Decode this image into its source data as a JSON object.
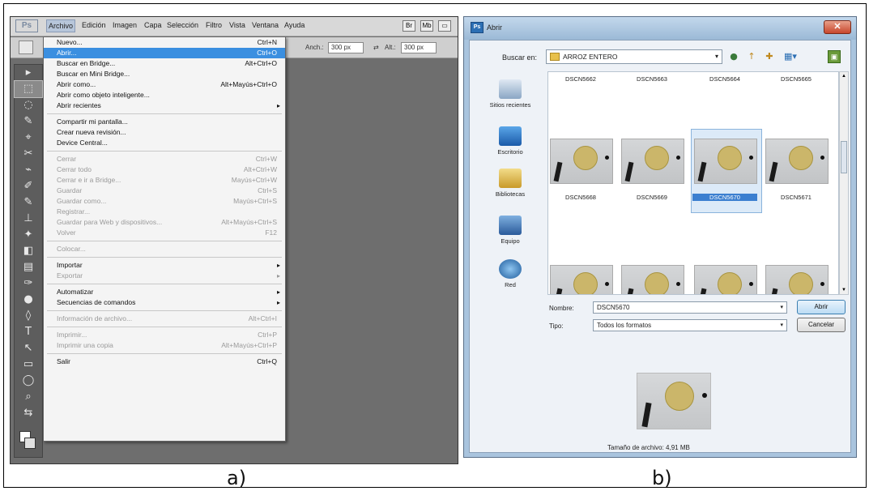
{
  "captions": {
    "a": "a)",
    "b": "b)"
  },
  "photoshop": {
    "logo": "Ps",
    "menus": [
      "Archivo",
      "Edición",
      "Imagen",
      "Capa",
      "Selección",
      "Filtro",
      "Vista",
      "Ventana",
      "Ayuda"
    ],
    "options": {
      "width_label": "Anch.:",
      "width_value": "300 px",
      "height_label": "Alt.:",
      "height_value": "300 px"
    },
    "tools": [
      "▸",
      "⬚",
      "◌",
      "✎",
      "⌖",
      "✂",
      "⌁",
      "✐",
      "✎",
      "⊥",
      "✦",
      "◧",
      "▤",
      "✑",
      "●",
      "◊",
      "T",
      "↖",
      "▭",
      "◯",
      "⌕",
      "⇆"
    ],
    "file_menu": [
      {
        "label": "Nuevo...",
        "shortcut": "Ctrl+N",
        "state": "normal"
      },
      {
        "label": "Abrir...",
        "shortcut": "Ctrl+O",
        "state": "highlight"
      },
      {
        "label": "Buscar en Bridge...",
        "shortcut": "Alt+Ctrl+O",
        "state": "normal"
      },
      {
        "label": "Buscar en Mini Bridge...",
        "shortcut": "",
        "state": "normal"
      },
      {
        "label": "Abrir como...",
        "shortcut": "Alt+Mayús+Ctrl+O",
        "state": "normal"
      },
      {
        "label": "Abrir como objeto inteligente...",
        "shortcut": "",
        "state": "normal"
      },
      {
        "label": "Abrir recientes",
        "shortcut": "",
        "state": "submenu"
      },
      {
        "sep": true
      },
      {
        "label": "Compartir mi pantalla...",
        "shortcut": "",
        "state": "normal"
      },
      {
        "label": "Crear nueva revisión...",
        "shortcut": "",
        "state": "normal"
      },
      {
        "label": "Device Central...",
        "shortcut": "",
        "state": "normal"
      },
      {
        "sep": true
      },
      {
        "label": "Cerrar",
        "shortcut": "Ctrl+W",
        "state": "disabled"
      },
      {
        "label": "Cerrar todo",
        "shortcut": "Alt+Ctrl+W",
        "state": "disabled"
      },
      {
        "label": "Cerrar e ir a Bridge...",
        "shortcut": "Mayús+Ctrl+W",
        "state": "disabled"
      },
      {
        "label": "Guardar",
        "shortcut": "Ctrl+S",
        "state": "disabled"
      },
      {
        "label": "Guardar como...",
        "shortcut": "Mayús+Ctrl+S",
        "state": "disabled"
      },
      {
        "label": "Registrar...",
        "shortcut": "",
        "state": "disabled"
      },
      {
        "label": "Guardar para Web y dispositivos...",
        "shortcut": "Alt+Mayús+Ctrl+S",
        "state": "disabled"
      },
      {
        "label": "Volver",
        "shortcut": "F12",
        "state": "disabled"
      },
      {
        "sep": true
      },
      {
        "label": "Colocar...",
        "shortcut": "",
        "state": "disabled"
      },
      {
        "sep": true
      },
      {
        "label": "Importar",
        "shortcut": "",
        "state": "submenu"
      },
      {
        "label": "Exportar",
        "shortcut": "",
        "state": "submenu-disabled"
      },
      {
        "sep": true
      },
      {
        "label": "Automatizar",
        "shortcut": "",
        "state": "submenu"
      },
      {
        "label": "Secuencias de comandos",
        "shortcut": "",
        "state": "submenu"
      },
      {
        "sep": true
      },
      {
        "label": "Información de archivo...",
        "shortcut": "Alt+Ctrl+I",
        "state": "disabled"
      },
      {
        "sep": true
      },
      {
        "label": "Imprimir...",
        "shortcut": "Ctrl+P",
        "state": "disabled"
      },
      {
        "label": "Imprimir una copia",
        "shortcut": "Alt+Mayús+Ctrl+P",
        "state": "disabled"
      },
      {
        "sep": true
      },
      {
        "label": "Salir",
        "shortcut": "Ctrl+Q",
        "state": "normal"
      }
    ]
  },
  "dialog": {
    "title": "Abrir",
    "close_glyph": "✕",
    "look_in_label": "Buscar en:",
    "look_in_value": "ARROZ ENTERO",
    "toolbar_icons": [
      "●",
      "↑",
      "✚",
      "▦▾"
    ],
    "places": [
      "Sitios recientes",
      "Escritorio",
      "Bibliotecas",
      "Equipo",
      "Red"
    ],
    "files_top_row": [
      "DSCN5662",
      "DSCN5663",
      "DSCN5664",
      "DSCN5665"
    ],
    "files_mid_row": [
      "DSCN5668",
      "DSCN5669",
      "DSCN5670",
      "DSCN5671"
    ],
    "selected_file": "DSCN5670",
    "name_label": "Nombre:",
    "name_value": "DSCN5670",
    "type_label": "Tipo:",
    "type_value": "Todos los formatos",
    "open_button": "Abrir",
    "cancel_button": "Cancelar",
    "file_size": "Tamaño de archivo: 4,91 MB",
    "dropdown_glyph": "▾"
  }
}
